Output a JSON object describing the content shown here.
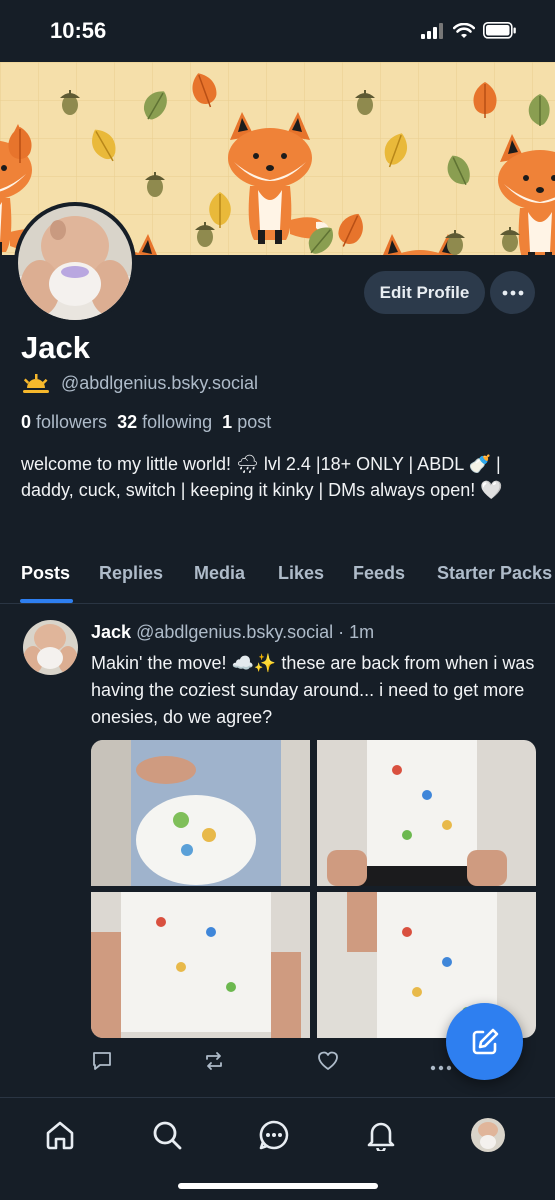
{
  "status_bar": {
    "time": "10:56"
  },
  "profile": {
    "display_name": "Jack",
    "handle_emoji": "☀",
    "handle": "@abdlgenius.bsky.social",
    "edit_label": "Edit Profile",
    "followers_count": "0",
    "followers_label": "followers",
    "following_count": "32",
    "following_label": "following",
    "posts_count": "1",
    "posts_label": "post",
    "bio": "welcome to my little world! 🌧 lvl 2.4 |18+ ONLY | ABDL 🍼 | daddy, cuck, switch | keeping it kinky | DMs always open! 🤍"
  },
  "tabs": [
    {
      "label": "Posts"
    },
    {
      "label": "Replies"
    },
    {
      "label": "Media"
    },
    {
      "label": "Likes"
    },
    {
      "label": "Feeds"
    },
    {
      "label": "Starter Packs"
    }
  ],
  "post": {
    "author": "Jack",
    "handle": "@abdlgenius.bsky.social",
    "separator": "·",
    "time": "1m",
    "text": "Makin' the move! ☁️✨ these are back from when i was having the coziest sunday around... i need to get more onesies, do we agree?"
  },
  "icons": {
    "reply": "speech-bubble-icon",
    "repost": "repost-icon",
    "like": "heart-icon",
    "more": "ellipsis-icon",
    "compose": "compose-icon",
    "home": "home-icon",
    "search": "search-icon",
    "chat": "chat-icon",
    "notifications": "bell-icon"
  },
  "colors": {
    "background": "#161e27",
    "accent": "#2e7ff0",
    "button": "#2c3a4b",
    "muted_text": "#aebbc9"
  }
}
